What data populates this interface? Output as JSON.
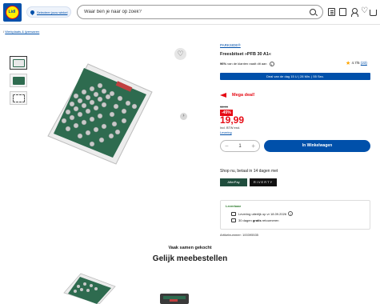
{
  "header": {
    "logo_text": "Lidl",
    "store_select": "Selecteer jouw winkel",
    "search_placeholder": "Waar ben je naar op zoek?"
  },
  "breadcrumb": {
    "sep": "/",
    "current": "Werkplaats & ijzerwaren"
  },
  "product": {
    "brand": "PARKSIDE®",
    "title": "Freesbitset »PFB 30 A1«",
    "recommend_pct": "96%",
    "recommend_text": "van de klanten raadt dit aan",
    "rating": "4.7/5",
    "review_count": "(23)",
    "deal_bar": "Deal van de dag 15 U | 28 Min. | 55 Sec.",
    "mega_deal": "Mega deal!",
    "old_price": "36,99",
    "discount": "-45%",
    "price": "19,99",
    "vat": "Incl. BTW excl.",
    "delivery_link": "Levering",
    "quantity": "1",
    "add_to_cart": "In Winkelwagen"
  },
  "payment": {
    "shop_now": "Shop nu, betaal in 14 dagen met",
    "option1": "AfterPay",
    "option2": "RIVERTY"
  },
  "delivery": {
    "availability": "Leverbaar",
    "line1": "Levering uiterlijk op vr 18.09.2026",
    "line2_pre": "30 dagen",
    "line2_bold": "gratis",
    "line2_post": "retourneren",
    "article": "Artikelnummer: 100395535"
  },
  "recommendations": {
    "bought_together": "Vaak samen gekocht",
    "order_also": "Gelijk meebestellen"
  },
  "colors": {
    "lidl_blue": "#0050aa",
    "lidl_red": "#e60a14",
    "lidl_yellow": "#fff000",
    "case_green": "#2e6b4f"
  }
}
